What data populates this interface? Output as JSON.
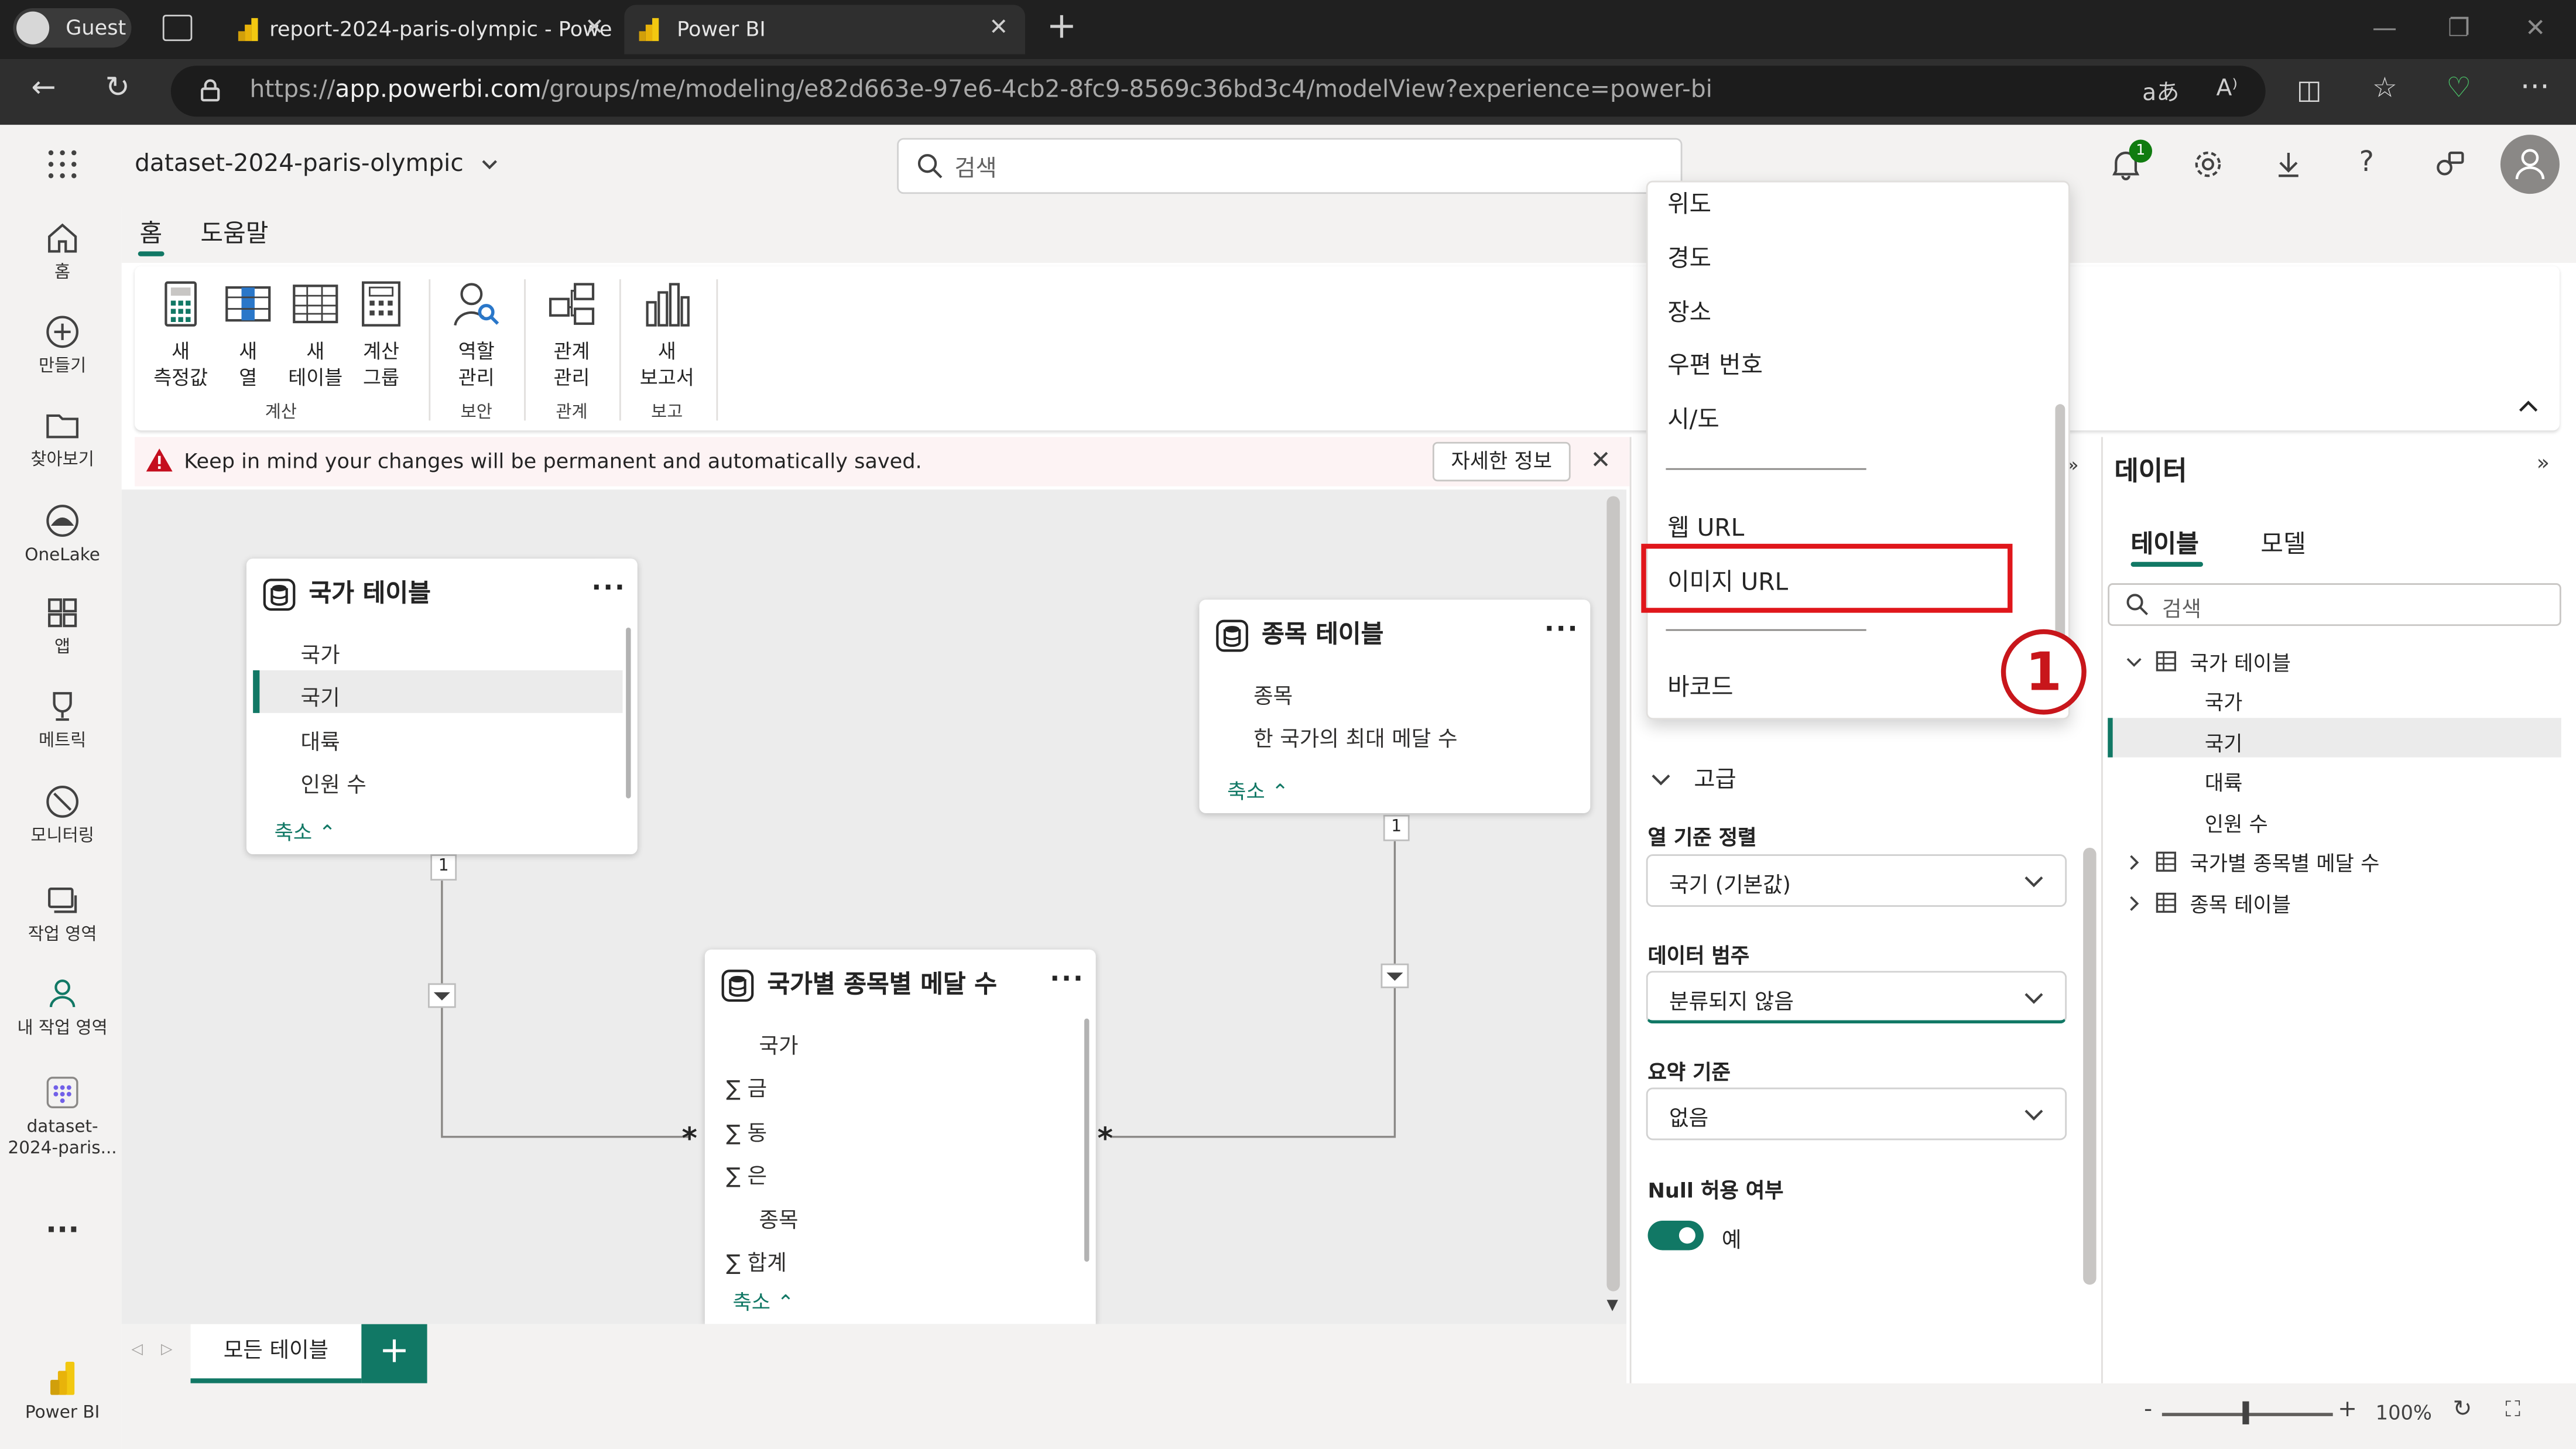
{
  "browser": {
    "guest_label": "Guest",
    "tabs": [
      {
        "title": "report-2024-paris-olympic - Powe"
      },
      {
        "title": "Power BI"
      }
    ],
    "url_prefix": "https://",
    "url_host": "app.powerbi.com",
    "url_path": "/groups/me/modeling/e82d663e-97e6-4cb2-8fc9-8569c36bd3c4/modelView?experience=power-bi"
  },
  "header": {
    "dataset_name": "dataset-2024-paris-olympic",
    "search_placeholder": "검색",
    "notification_count": "1"
  },
  "rail": {
    "items": [
      {
        "label": "홈"
      },
      {
        "label": "만들기"
      },
      {
        "label": "찾아보기"
      },
      {
        "label": "OneLake"
      },
      {
        "label": "앱"
      },
      {
        "label": "메트릭"
      },
      {
        "label": "모니터링"
      },
      {
        "label": "작업 영역"
      },
      {
        "label": "내 작업 영역"
      },
      {
        "label": "dataset-"
      },
      {
        "label": "2024-paris..."
      },
      {
        "label": "Power BI"
      }
    ],
    "more": "..."
  },
  "ribbon": {
    "tabs": [
      "홈",
      "도움말"
    ],
    "buttons": [
      {
        "l1": "새",
        "l2": "측정값"
      },
      {
        "l1": "새",
        "l2": "열"
      },
      {
        "l1": "새",
        "l2": "테이블"
      },
      {
        "l1": "계산",
        "l2": "그룹"
      },
      {
        "l1": "역할",
        "l2": "관리"
      },
      {
        "l1": "관계",
        "l2": "관리"
      },
      {
        "l1": "새",
        "l2": "보고서"
      }
    ],
    "groups": [
      "계산",
      "보안",
      "관계",
      "보고"
    ]
  },
  "warning": {
    "text": "Keep in mind your changes will be permanent and automatically saved.",
    "details_button": "자세한 정보"
  },
  "tables": {
    "country": {
      "title": "국가 테이블",
      "fields": [
        "국가",
        "국기",
        "대륙",
        "인원 수"
      ],
      "collapse": "축소"
    },
    "sport": {
      "title": "종목 테이블",
      "fields": [
        "종목",
        "한 국가의 최대 메달 수"
      ],
      "collapse": "축소"
    },
    "medals": {
      "title": "국가별 종목별 메달 수",
      "fields": [
        "국가",
        "금",
        "동",
        "은",
        "종목",
        "합계"
      ],
      "sigma": "∑",
      "collapse": "축소"
    },
    "rel_one": "1",
    "rel_many": "*"
  },
  "pages": {
    "tab": "모든 테이블",
    "add": "+"
  },
  "menu": {
    "items": [
      "위도",
      "경도",
      "장소",
      "우편 번호",
      "시/도",
      "웹 URL",
      "이미지 URL",
      "바코드"
    ],
    "annotation": "1"
  },
  "properties": {
    "advanced": "고급",
    "sort_by_label": "열 기준 정렬",
    "sort_by_value": "국기 (기본값)",
    "category_label": "데이터 범주",
    "category_value": "분류되지 않음",
    "summarize_label": "요약 기준",
    "summarize_value": "없음",
    "nullable_label": "Null 허용 여부",
    "nullable_value": "예"
  },
  "datapane": {
    "title": "데이터",
    "tabs": [
      "테이블",
      "모델"
    ],
    "search_placeholder": "검색",
    "tree": {
      "country_table": "국가 테이블",
      "country_fields": [
        "국가",
        "국기",
        "대륙",
        "인원 수"
      ],
      "medals_table": "국가별 종목별 메달 수",
      "sport_table": "종목 테이블"
    }
  },
  "status": {
    "zoom": "100%",
    "minus": "-",
    "plus": "+"
  },
  "colors": {
    "accent": "#117865",
    "highlight": "#e0161b",
    "chrome": "#202020"
  }
}
